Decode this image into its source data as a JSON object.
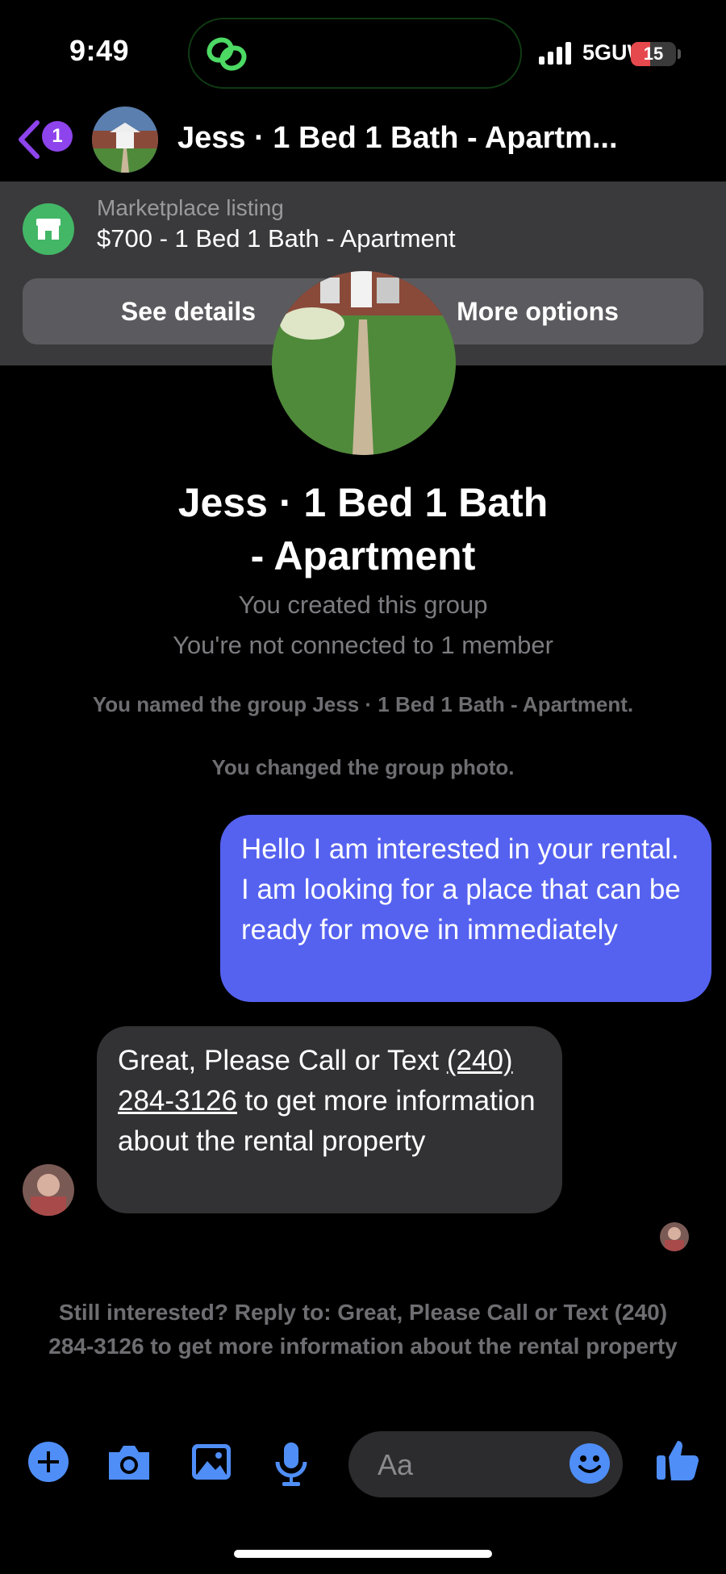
{
  "status_bar": {
    "time": "9:49",
    "network": "5GUW",
    "battery": "15",
    "battery_level": 0.15
  },
  "header": {
    "back_badge": "1",
    "title": "Jess · 1 Bed 1 Bath - Apartm..."
  },
  "listing": {
    "label": "Marketplace listing",
    "title": "$700 - 1 Bed 1 Bath - Apartment",
    "see_details": "See details",
    "more_options": "More options"
  },
  "group": {
    "name_line1": "Jess · 1 Bed 1 Bath",
    "name_line2": "- Apartment",
    "created": "You created this group",
    "connected": "You're not connected to 1 member",
    "event_named": "You named the group Jess · 1 Bed 1 Bath - Apartment.",
    "event_photo": "You changed the group photo."
  },
  "messages": {
    "outgoing": "Hello I am interested in your rental. I am looking for a place that can be ready for move in immediately",
    "incoming_before": "Great, Please Call or Text ",
    "incoming_phone": "(240) 284-3126",
    "incoming_after": " to get more information about the rental property"
  },
  "prompt": "Still interested? Reply to: Great, Please Call or Text (240) 284-3126 to get more information about the rental property",
  "composer": {
    "placeholder": "Aa"
  },
  "colors": {
    "accent": "#5562f0",
    "icon_blue": "#4f8ef7",
    "back_purple": "#8e44ec",
    "marketplace_green": "#43b766"
  }
}
